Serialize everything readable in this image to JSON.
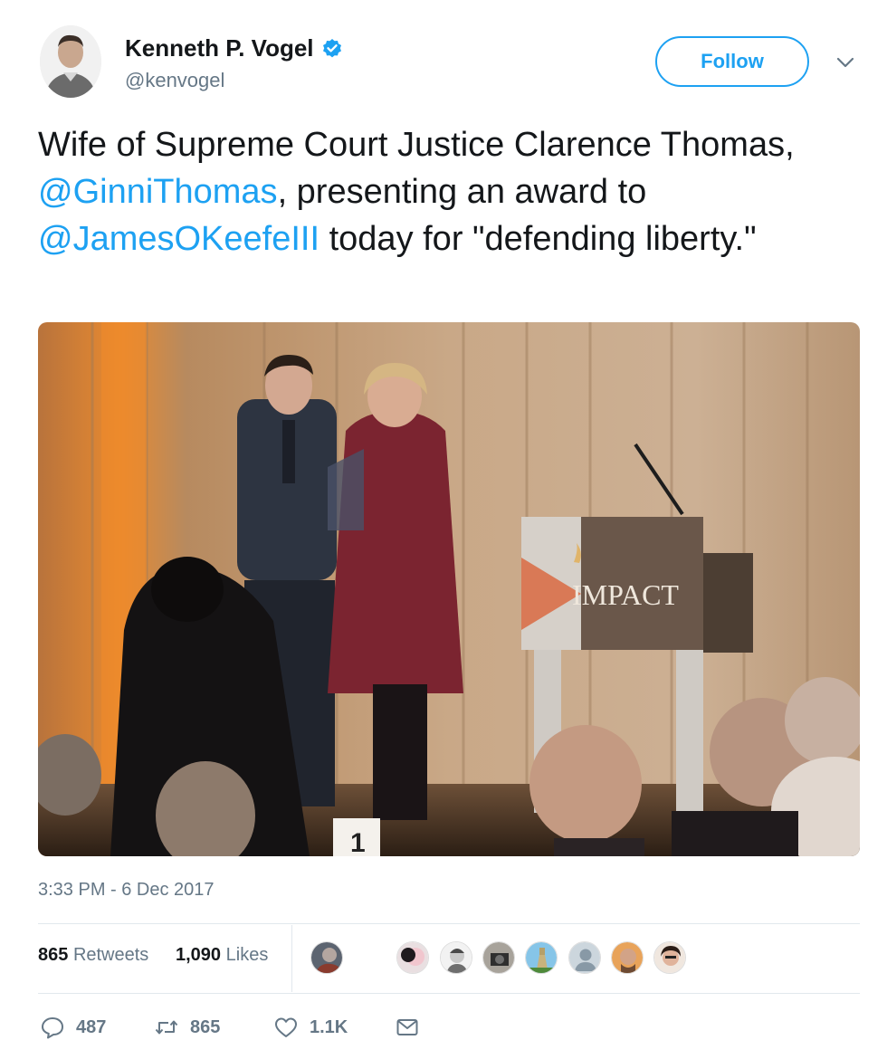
{
  "author": {
    "name": "Kenneth P. Vogel",
    "handle": "@kenvogel",
    "verified": true
  },
  "follow_label": "Follow",
  "tweet": {
    "part1": "Wife of Supreme Court Justice Clarence Thomas, ",
    "mention1": "@GinniThomas",
    "part2": ", presenting an award to ",
    "mention2": "@JamesOKeefeIII",
    "part3": " today for \"defending liberty.\"",
    "photo_text": "IMPACT",
    "card_number": "1"
  },
  "timestamp": "3:33 PM - 6 Dec 2017",
  "stats": {
    "retweets_count": "865",
    "retweets_label": "Retweets",
    "likes_count": "1,090",
    "likes_label": "Likes"
  },
  "actions": {
    "reply_count": "487",
    "retweet_count": "865",
    "like_count": "1.1K"
  },
  "colors": {
    "accent": "#1da1f2",
    "muted": "#657786",
    "text": "#14171a",
    "verified": "#1da1f2"
  }
}
